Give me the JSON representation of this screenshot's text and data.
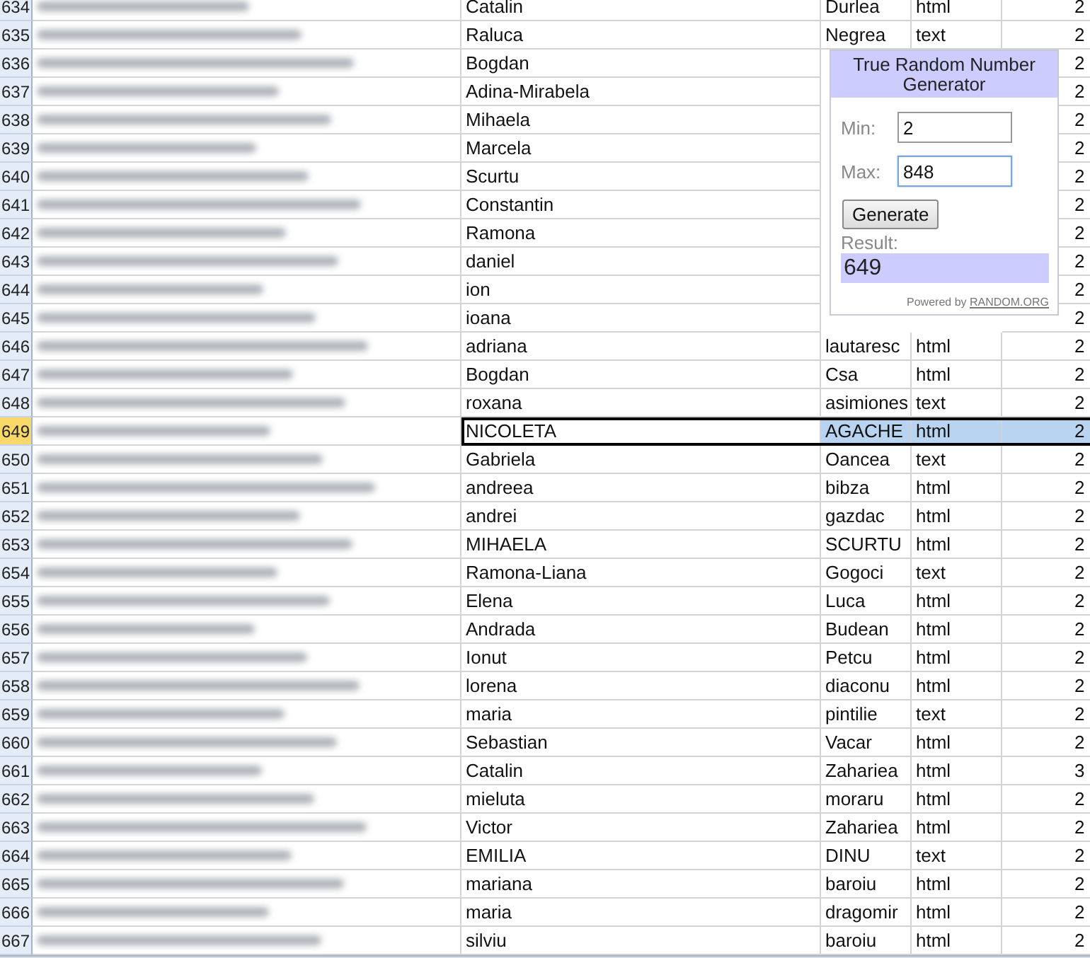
{
  "rows": [
    {
      "number": "634",
      "selected": false,
      "column_2": "Catalin",
      "column_3": "Durlea",
      "column_4": "html",
      "column_5": "2"
    },
    {
      "number": "635",
      "selected": false,
      "column_2": "Raluca",
      "column_3": "Negrea",
      "column_4": "text",
      "column_5": "2"
    },
    {
      "number": "636",
      "selected": false,
      "column_2": "Bogdan",
      "column_5": "2"
    },
    {
      "number": "637",
      "selected": false,
      "column_2": "Adina-Mirabela",
      "column_5": "2"
    },
    {
      "number": "638",
      "selected": false,
      "column_2": "Mihaela",
      "column_5": "2"
    },
    {
      "number": "639",
      "selected": false,
      "column_2": "Marcela",
      "column_5": "2"
    },
    {
      "number": "640",
      "selected": false,
      "column_2": "Scurtu",
      "column_5": "2"
    },
    {
      "number": "641",
      "selected": false,
      "column_2": "Constantin",
      "column_5": "2"
    },
    {
      "number": "642",
      "selected": false,
      "column_2": "Ramona",
      "column_5": "2"
    },
    {
      "number": "643",
      "selected": false,
      "column_2": "daniel",
      "column_5": "2"
    },
    {
      "number": "644",
      "selected": false,
      "column_2": "ion",
      "column_5": "2"
    },
    {
      "number": "645",
      "selected": false,
      "column_2": "ioana",
      "column_5": "2"
    },
    {
      "number": "646",
      "selected": false,
      "column_2": "adriana",
      "column_3": "lautaresc",
      "column_4": "html",
      "column_5": "2"
    },
    {
      "number": "647",
      "selected": false,
      "column_2": "Bogdan",
      "column_3": "Csa",
      "column_4": "html",
      "column_5": "2"
    },
    {
      "number": "648",
      "selected": false,
      "column_2": "roxana",
      "column_3": "asimiones",
      "column_4": "text",
      "column_5": "2"
    },
    {
      "number": "649",
      "selected": true,
      "column_2": "NICOLETA",
      "column_3": "AGACHE",
      "column_4": "html",
      "column_5": "2"
    },
    {
      "number": "650",
      "selected": false,
      "column_2": "Gabriela",
      "column_3": "Oancea",
      "column_4": "text",
      "column_5": "2"
    },
    {
      "number": "651",
      "selected": false,
      "column_2": "andreea",
      "column_3": "bibza",
      "column_4": "html",
      "column_5": "2"
    },
    {
      "number": "652",
      "selected": false,
      "column_2": "andrei",
      "column_3": "gazdac",
      "column_4": "html",
      "column_5": "2"
    },
    {
      "number": "653",
      "selected": false,
      "column_2": "MIHAELA",
      "column_3": "SCURTU",
      "column_4": "html",
      "column_5": "2"
    },
    {
      "number": "654",
      "selected": false,
      "column_2": "Ramona-Liana",
      "column_3": "Gogoci",
      "column_4": "text",
      "column_5": "2"
    },
    {
      "number": "655",
      "selected": false,
      "column_2": "Elena",
      "column_3": "Luca",
      "column_4": "html",
      "column_5": "2"
    },
    {
      "number": "656",
      "selected": false,
      "column_2": "Andrada",
      "column_3": "Budean",
      "column_4": "html",
      "column_5": "2"
    },
    {
      "number": "657",
      "selected": false,
      "column_2": "Ionut",
      "column_3": "Petcu",
      "column_4": "html",
      "column_5": "2"
    },
    {
      "number": "658",
      "selected": false,
      "column_2": "lorena",
      "column_3": "diaconu",
      "column_4": "html",
      "column_5": "2"
    },
    {
      "number": "659",
      "selected": false,
      "column_2": "maria",
      "column_3": "pintilie",
      "column_4": "text",
      "column_5": "2"
    },
    {
      "number": "660",
      "selected": false,
      "column_2": "Sebastian",
      "column_3": "Vacar",
      "column_4": "html",
      "column_5": "2"
    },
    {
      "number": "661",
      "selected": false,
      "column_2": "Catalin",
      "column_3": "Zahariea",
      "column_4": "html",
      "column_5": "3"
    },
    {
      "number": "662",
      "selected": false,
      "column_2": "mieluta",
      "column_3": "moraru",
      "column_4": "html",
      "column_5": "2"
    },
    {
      "number": "663",
      "selected": false,
      "column_2": "Victor",
      "column_3": "Zahariea",
      "column_4": "html",
      "column_5": "2"
    },
    {
      "number": "664",
      "selected": false,
      "column_2": "EMILIA",
      "column_3": "DINU",
      "column_4": "text",
      "column_5": "2"
    },
    {
      "number": "665",
      "selected": false,
      "column_2": "mariana",
      "column_3": "baroiu",
      "column_4": "html",
      "column_5": "2"
    },
    {
      "number": "666",
      "selected": false,
      "column_2": "maria",
      "column_3": "dragomir",
      "column_4": "html",
      "column_5": "2"
    },
    {
      "number": "667",
      "selected": false,
      "column_2": "silviu",
      "column_3": "baroiu",
      "column_4": "html",
      "column_5": "2"
    }
  ],
  "generator": {
    "title": "True Random Number Generator",
    "min_label": "Min:",
    "min_value": "2",
    "max_label": "Max:",
    "max_value": "848",
    "button": "Generate",
    "result_label": "Result:",
    "result": "649",
    "powered_by": "Powered by",
    "link": "RANDOM.ORG"
  }
}
